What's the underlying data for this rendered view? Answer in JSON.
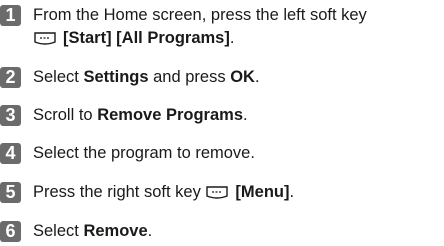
{
  "steps": [
    {
      "num": "1",
      "text_a": "From the Home screen, press the left soft key",
      "key_icon": "left-soft-key-icon",
      "bold_b": "[Start] [All Programs]",
      "text_c": "."
    },
    {
      "num": "2",
      "text_a": "Select ",
      "bold_b": "Settings",
      "text_c": " and press ",
      "bold_d": "OK",
      "text_e": "."
    },
    {
      "num": "3",
      "text_a": "Scroll to ",
      "bold_b": "Remove Programs",
      "text_c": "."
    },
    {
      "num": "4",
      "text_a": "Select the program to remove."
    },
    {
      "num": "5",
      "text_a": "Press the right soft key ",
      "key_icon": "right-soft-key-icon",
      "bold_b": "[Menu]",
      "text_c": "."
    },
    {
      "num": "6",
      "text_a": "Select ",
      "bold_b": "Remove",
      "text_c": "."
    }
  ]
}
